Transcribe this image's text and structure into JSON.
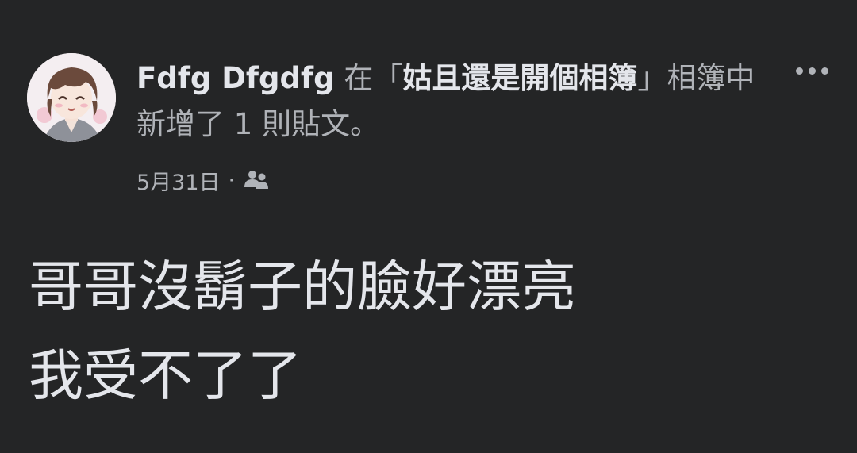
{
  "post": {
    "author_name": "Fdfg Dfgdfg",
    "action_prefix": " 在「",
    "album_name": "姑且還是開個相簿",
    "action_suffix": "」相簿中新增了 1 則貼文。",
    "date": "5月31日",
    "separator": "·",
    "audience_icon": "friends-icon",
    "more_icon": "more-options-icon",
    "body_lines": [
      "哥哥沒鬍子的臉好漂亮",
      "我受不了了"
    ]
  },
  "colors": {
    "background": "#242526",
    "primary_text": "#e4e6eb",
    "secondary_text": "#b0b3b8"
  }
}
